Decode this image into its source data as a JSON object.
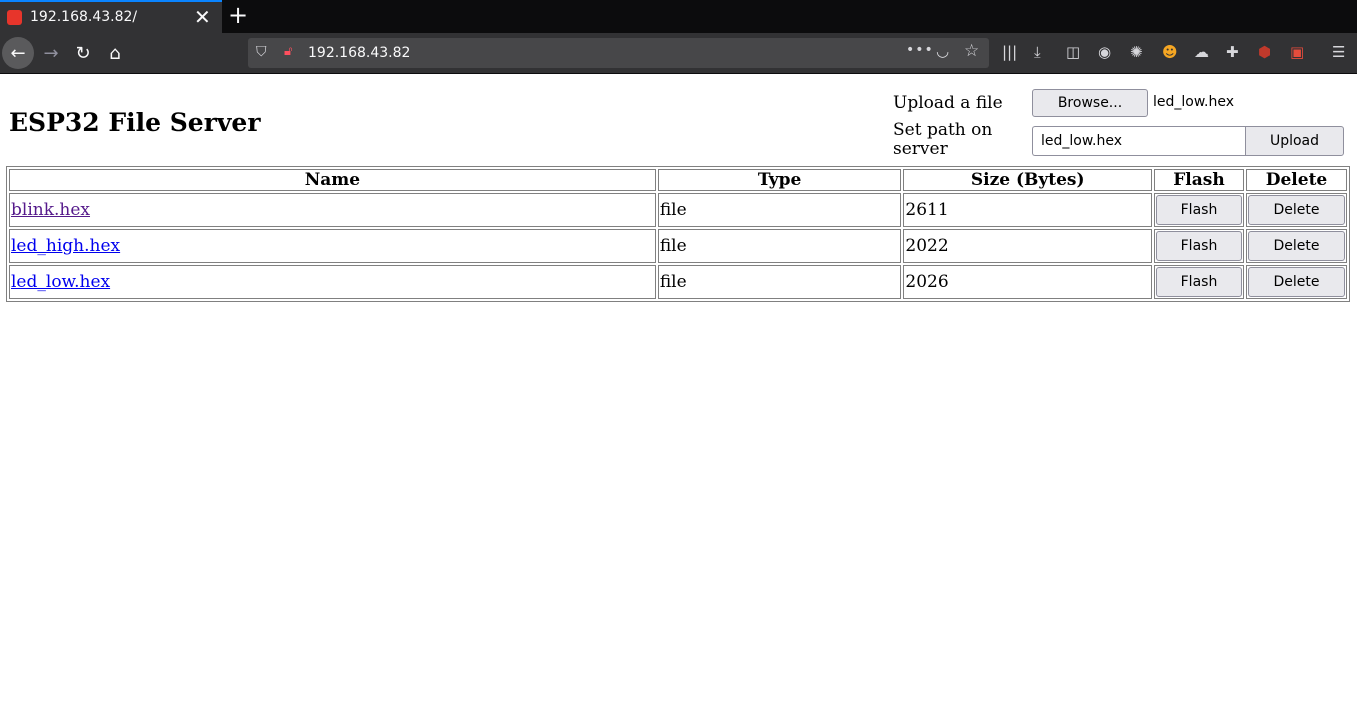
{
  "browser": {
    "tab_title": "192.168.43.82/",
    "tab_close": "✕",
    "new_tab": "+",
    "url": "192.168.43.82"
  },
  "page": {
    "title": "ESP32 File Server",
    "upload_label": "Upload a file",
    "browse_label": "Browse...",
    "chosen_file": "led_low.hex",
    "path_label": "Set path on server",
    "path_value": "led_low.hex",
    "upload_button": "Upload"
  },
  "table": {
    "headers": [
      "Name",
      "Type",
      "Size (Bytes)",
      "Flash",
      "Delete"
    ],
    "rows": [
      {
        "name": "blink.hex",
        "type": "file",
        "size": "2611",
        "flash": "Flash",
        "delete": "Delete"
      },
      {
        "name": "led_high.hex",
        "type": "file",
        "size": "2022",
        "flash": "Flash",
        "delete": "Delete"
      },
      {
        "name": "led_low.hex",
        "type": "file",
        "size": "2026",
        "flash": "Flash",
        "delete": "Delete"
      }
    ]
  },
  "icons": {
    "back": "arrow-left-icon",
    "forward": "arrow-right-icon",
    "reload": "reload-icon",
    "home": "home-icon"
  },
  "colors": {
    "link": "#0000ee",
    "visited_link": "#551a8b",
    "tab_accent": "#0a84ff"
  }
}
